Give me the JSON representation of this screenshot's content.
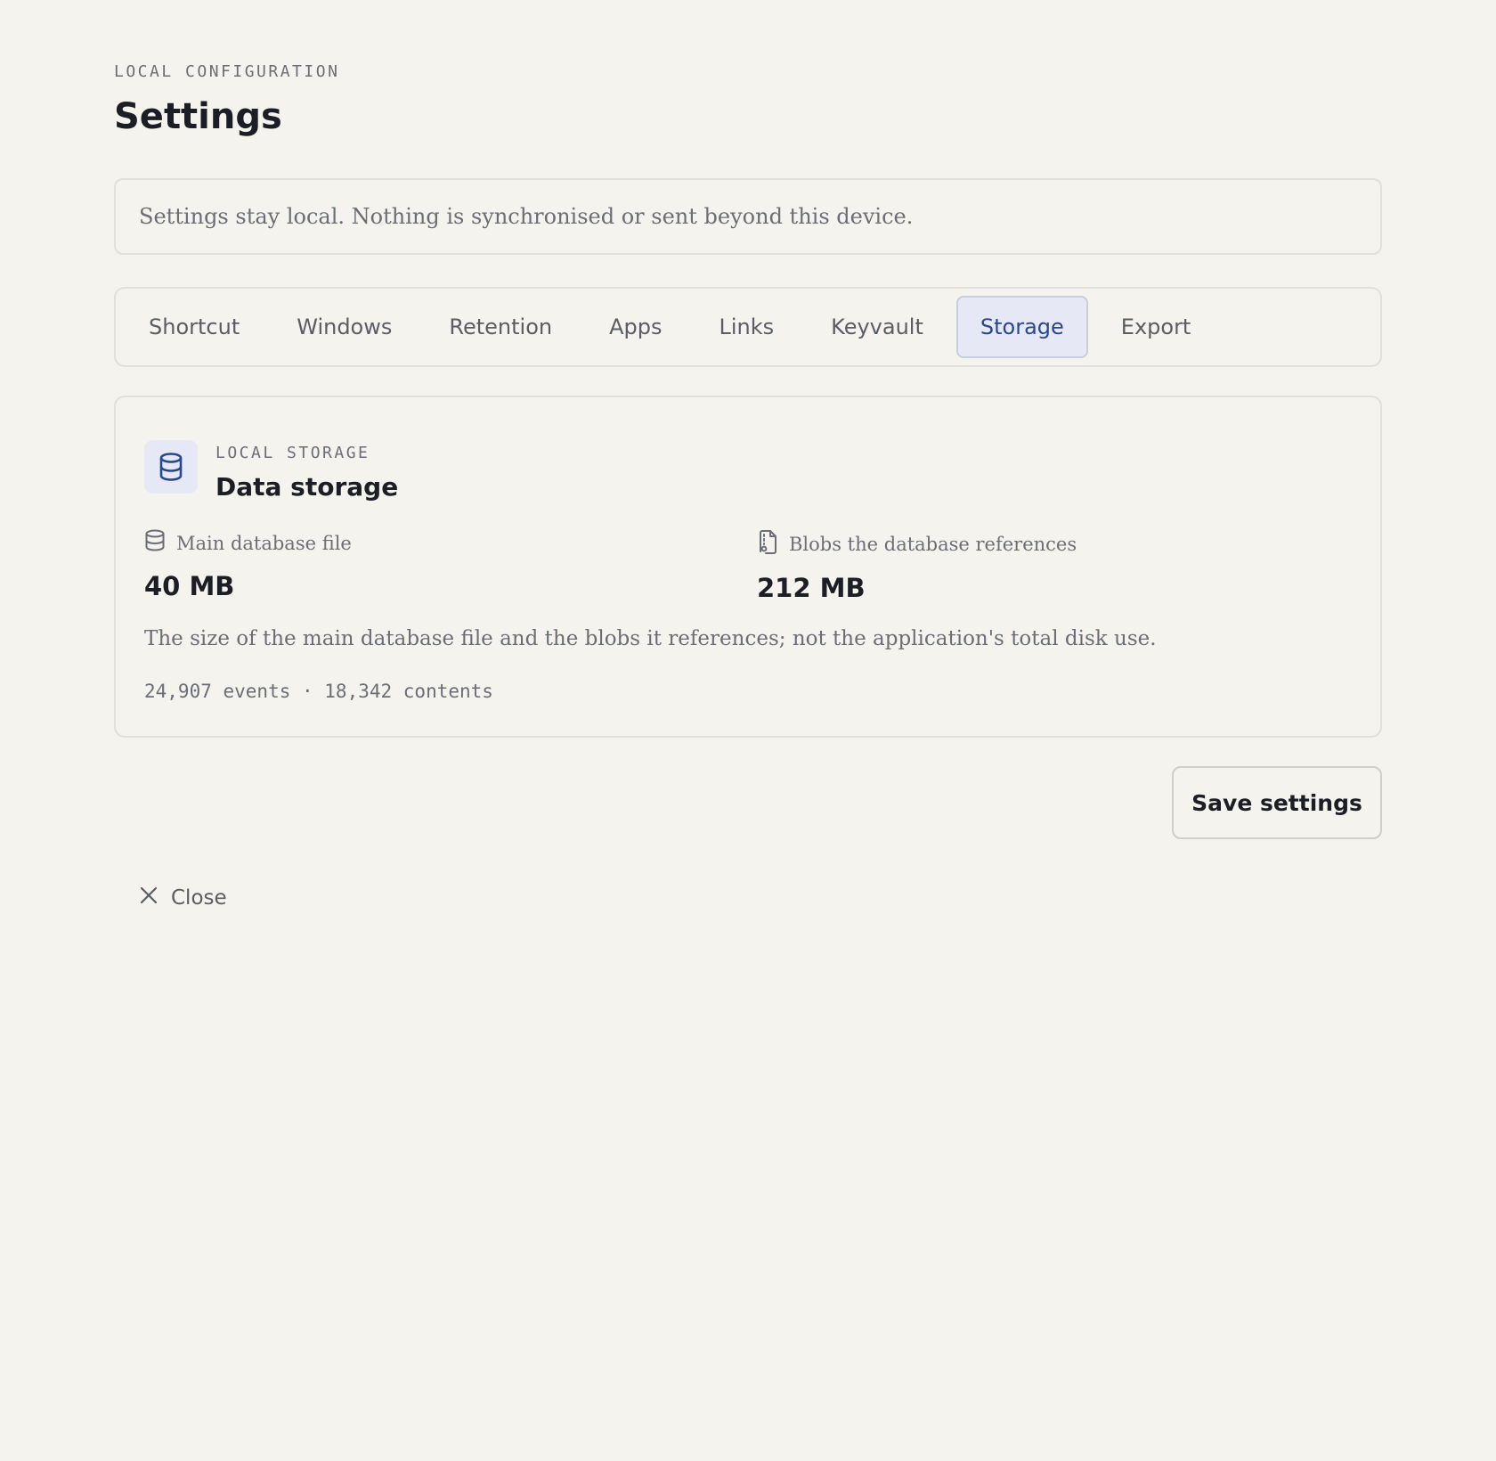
{
  "header": {
    "eyebrow": "LOCAL CONFIGURATION",
    "title": "Settings"
  },
  "notice": "Settings stay local. Nothing is synchronised or sent beyond this device.",
  "tabs": [
    {
      "label": "Shortcut",
      "active": false
    },
    {
      "label": "Windows",
      "active": false
    },
    {
      "label": "Retention",
      "active": false
    },
    {
      "label": "Apps",
      "active": false
    },
    {
      "label": "Links",
      "active": false
    },
    {
      "label": "Keyvault",
      "active": false
    },
    {
      "label": "Storage",
      "active": true
    },
    {
      "label": "Export",
      "active": false
    }
  ],
  "storage_card": {
    "icon": "database-icon",
    "eyebrow": "LOCAL STORAGE",
    "title": "Data storage",
    "main_db": {
      "icon": "database-icon",
      "label": "Main database file",
      "value": "40 MB"
    },
    "blobs": {
      "icon": "file-blob-icon",
      "label": "Blobs the database references",
      "value": "212 MB"
    },
    "description": "The size of the main database file and the blobs it references; not the application's total disk use.",
    "meta": "24,907 events · 18,342 contents"
  },
  "actions": {
    "save_label": "Save settings",
    "close_label": "Close"
  },
  "colors": {
    "background": "#f4f3ee",
    "accent": "#27478e",
    "accent_bg": "#e6e9f5",
    "text": "#1b1e25",
    "muted": "#6b6e76"
  }
}
